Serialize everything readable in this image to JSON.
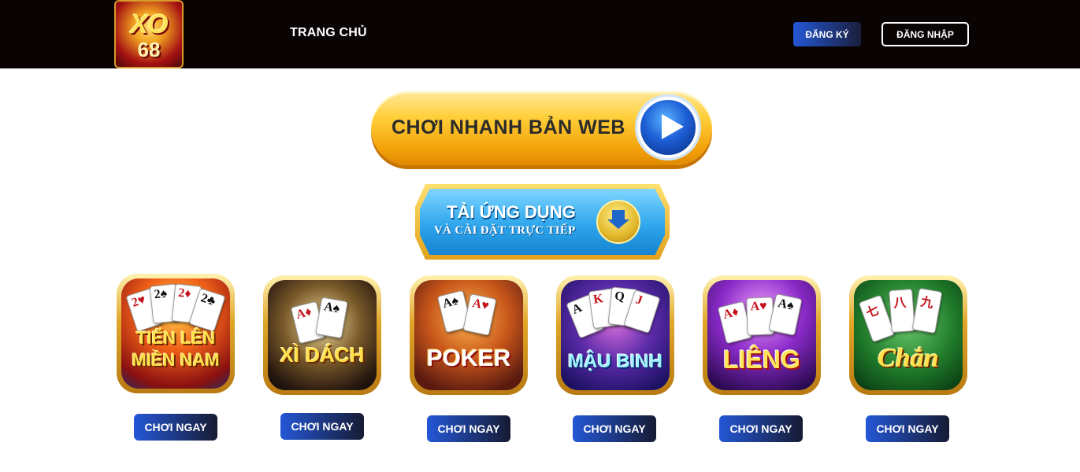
{
  "header": {
    "logo_text_top": "XO",
    "logo_text_bottom": "68",
    "nav_home": "TRANG CHỦ",
    "register_label": "ĐĂNG KÝ",
    "login_label": "ĐĂNG NHẬP"
  },
  "banners": {
    "play_web": "CHƠI NHANH BẢN WEB",
    "download_title": "TẢI ỨNG DỤNG",
    "download_subtitle": "VÀ CÀI ĐẶT TRỰC TIẾP"
  },
  "games": [
    {
      "title_line1": "TIẾN LÊN",
      "title_line2": "MIỀN NAM",
      "button": "CHƠI NGAY"
    },
    {
      "title_line1": "XÌ DÁCH",
      "title_line2": "",
      "button": "CHƠI NGAY"
    },
    {
      "title_line1": "POKER",
      "title_line2": "",
      "button": "CHƠI NGAY"
    },
    {
      "title_line1": "MẬU BINH",
      "title_line2": "",
      "button": "CHƠI NGAY"
    },
    {
      "title_line1": "LIÊNG",
      "title_line2": "",
      "button": "CHƠI NGAY"
    },
    {
      "title_line1": "Chắn",
      "title_line2": "",
      "button": "CHƠI NGAY"
    }
  ],
  "colors": {
    "header_bg": "#0a0304",
    "button_gradient_start": "#2457d6",
    "button_gradient_end": "#161b33",
    "gold": "#e0a528"
  }
}
